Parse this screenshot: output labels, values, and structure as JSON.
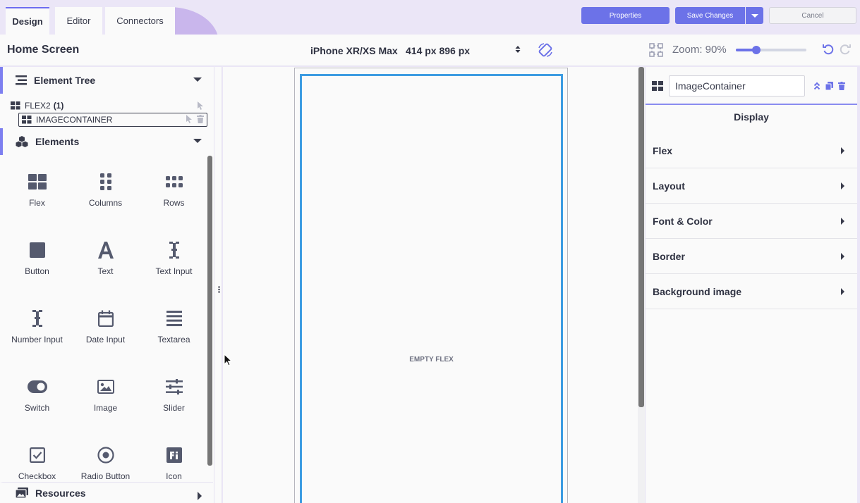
{
  "tabs": [
    {
      "label": "Design",
      "active": true
    },
    {
      "label": "Editor",
      "active": false
    },
    {
      "label": "Connectors",
      "active": false
    }
  ],
  "toolbar": {
    "properties_label": "Properties",
    "save_label": "Save Changes",
    "cancel_label": "Cancel"
  },
  "header": {
    "screen_title": "Home Screen",
    "device_name": "iPhone XR/XS Max",
    "device_resolution": "414 px 896 px",
    "zoom_label": "Zoom: 90%",
    "zoom_percent": 90,
    "zoom_slider_fraction": 0.29
  },
  "left_panel": {
    "element_tree_title": "Element Tree",
    "tree": [
      {
        "label": "FLEX2",
        "count": "(1)"
      },
      {
        "label": "IMAGECONTAINER",
        "selected": true
      }
    ],
    "elements_title": "Elements",
    "elements": [
      {
        "label": "Flex",
        "icon": "flex-icon"
      },
      {
        "label": "Columns",
        "icon": "columns-icon"
      },
      {
        "label": "Rows",
        "icon": "rows-icon"
      },
      {
        "label": "Button",
        "icon": "button-icon"
      },
      {
        "label": "Text",
        "icon": "text-icon"
      },
      {
        "label": "Text Input",
        "icon": "text-cursor-icon"
      },
      {
        "label": "Number Input",
        "icon": "text-cursor-icon"
      },
      {
        "label": "Date Input",
        "icon": "calendar-icon"
      },
      {
        "label": "Textarea",
        "icon": "textarea-icon"
      },
      {
        "label": "Switch",
        "icon": "toggle-icon"
      },
      {
        "label": "Image",
        "icon": "image-icon"
      },
      {
        "label": "Slider",
        "icon": "sliders-icon"
      },
      {
        "label": "Checkbox",
        "icon": "checkbox-icon"
      },
      {
        "label": "Radio Button",
        "icon": "radio-icon"
      },
      {
        "label": "Icon",
        "icon": "font-icon"
      }
    ],
    "resources_title": "Resources"
  },
  "canvas": {
    "empty_label": "EMPTY FLEX"
  },
  "right_panel": {
    "component_name": "ImageContainer",
    "section_title": "Display",
    "accordions": [
      "Flex",
      "Layout",
      "Font & Color",
      "Border",
      "Background image"
    ]
  },
  "colors": {
    "accent": "#6c72e8",
    "selection": "#3d9ce2",
    "icon": "#555a6e",
    "background": "#ebe6f7"
  }
}
